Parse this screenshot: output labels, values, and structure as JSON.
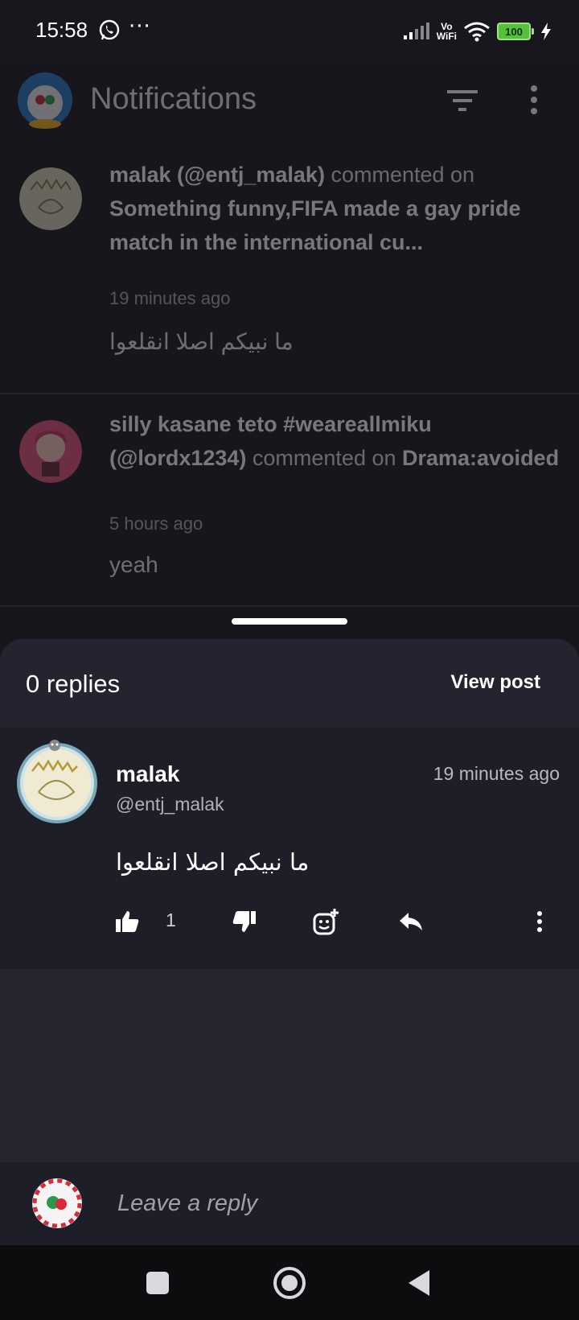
{
  "status_bar": {
    "time": "15:58",
    "vo": "Vo",
    "wifi_label": "WiFi",
    "battery": "100",
    "icons": [
      "whatsapp-icon",
      "more-icon",
      "signal-icon",
      "wifi-icon",
      "battery-icon",
      "charging-icon"
    ]
  },
  "app_bar": {
    "title": "Notifications"
  },
  "notifications": [
    {
      "user": "malak (@entj_malak)",
      "action": " commented on ",
      "post": "Something funny,FIFA made a gay pride match in the international cu...",
      "time": "19 minutes ago",
      "body": "ما نبيكم اصلا انقلعوا"
    },
    {
      "user": "silly kasane teto #weareallmiku (@lordx1234)",
      "action": " commented on ",
      "post": "Drama:avoided",
      "time": "5 hours ago",
      "body": "yeah"
    }
  ],
  "sheet": {
    "replies_count": "0 replies",
    "view_post": "View post",
    "comment": {
      "name": "malak",
      "handle": "@entj_malak",
      "time": "19 minutes ago",
      "body": "ما نبيكم اصلا انقلعوا",
      "like_count": "1"
    },
    "reply_placeholder": "Leave a reply"
  },
  "colors": {
    "background": "#16161c",
    "sheet": "#262631",
    "comment_bg": "#1e1e28",
    "battery": "#55c03a"
  }
}
